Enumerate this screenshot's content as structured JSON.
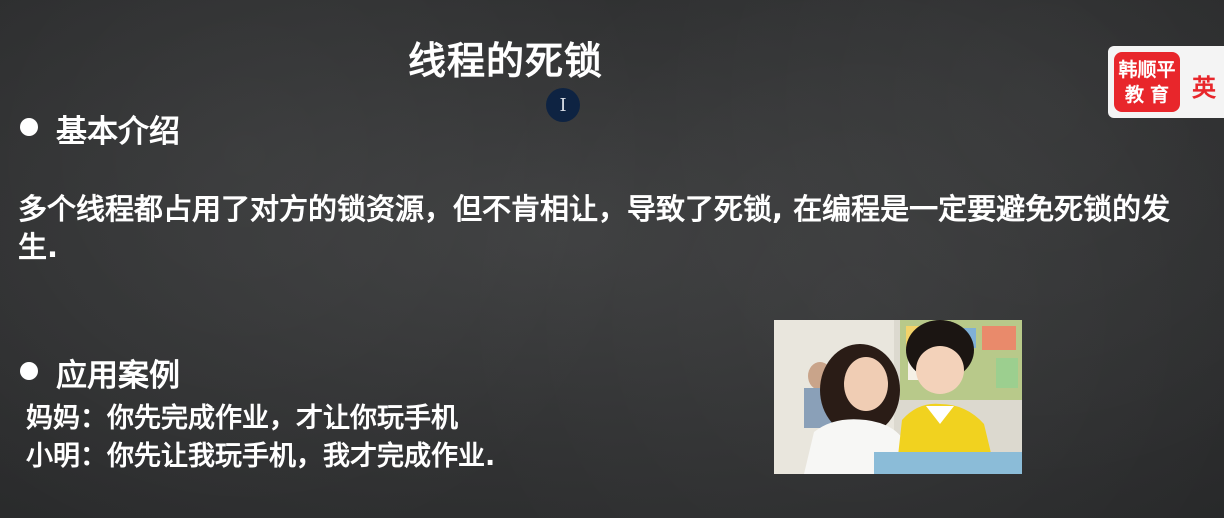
{
  "slide": {
    "title": "线程的死锁",
    "section1": {
      "heading": "基本介绍",
      "text": "多个线程都占用了对方的锁资源，但不肯相让，导致了死锁, 在编程是一定要避免死锁的发生."
    },
    "section2": {
      "heading": "应用案例",
      "lines": [
        "妈妈：你先完成作业，才让你玩手机",
        "小明：你先让我玩手机，我才完成作业."
      ]
    }
  },
  "logo": {
    "line1": "韩顺平",
    "line2": "教育",
    "side_text": "英"
  },
  "cursor": {
    "glyph": "I"
  },
  "colors": {
    "background": "#333435",
    "text": "#ffffff",
    "logo_red": "#e8262b",
    "cursor_bg": "#0e2342"
  }
}
